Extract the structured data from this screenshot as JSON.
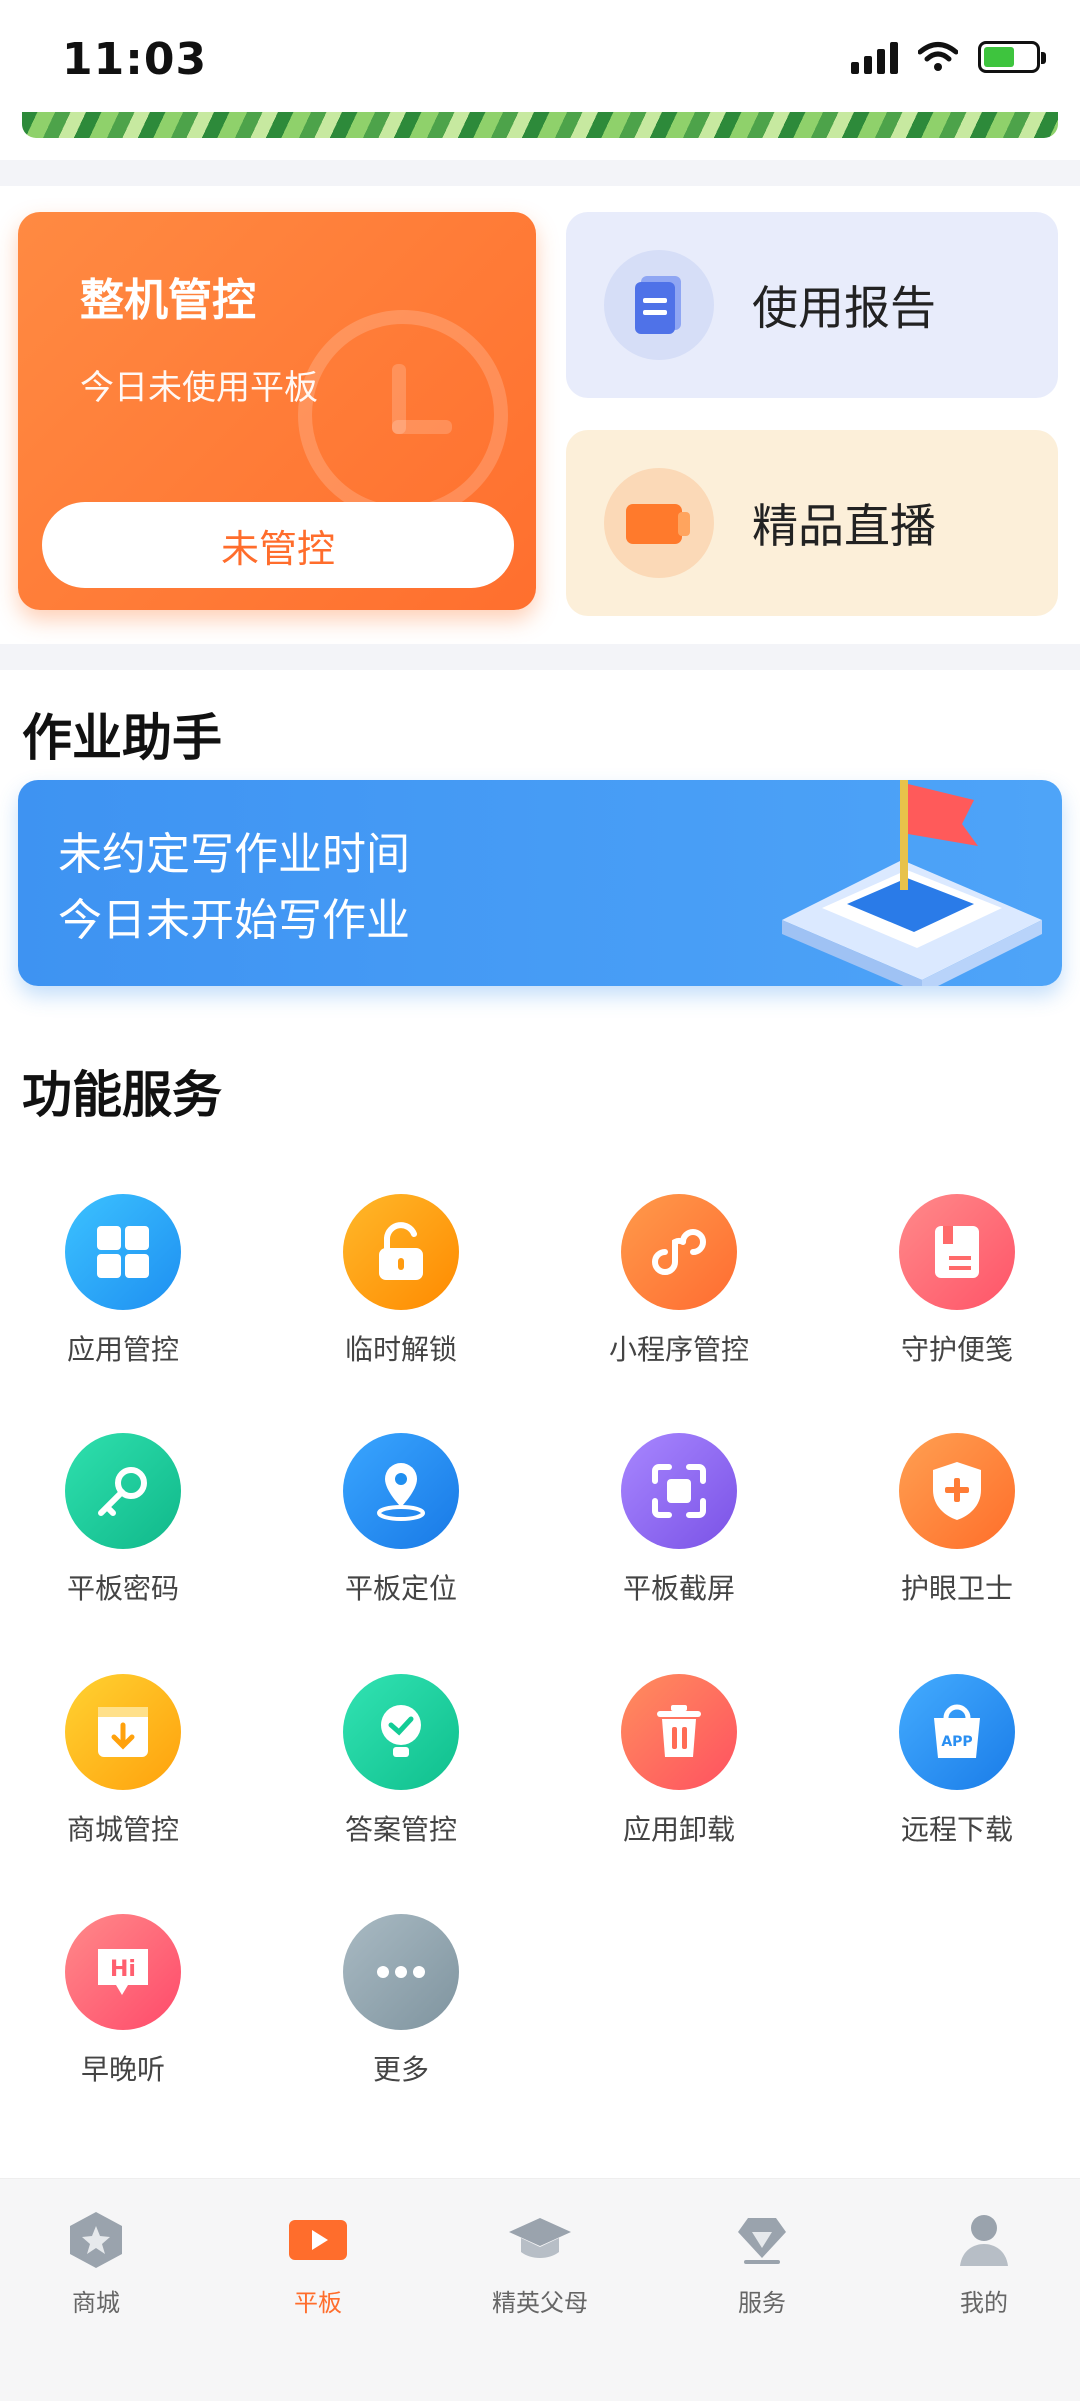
{
  "status_bar": {
    "time": "11:03"
  },
  "control_card": {
    "title": "整机管控",
    "subtitle": "今日未使用平板",
    "button_label": "未管控"
  },
  "report_card": {
    "label": "使用报告"
  },
  "live_card": {
    "label": "精品直播"
  },
  "homework": {
    "section_title": "作业助手",
    "line1": "未约定写作业时间",
    "line2": "今日未开始写作业"
  },
  "services": {
    "section_title": "功能服务",
    "items": [
      {
        "label": "应用管控",
        "icon": "apps-grid-icon",
        "color": "#1e9ef1"
      },
      {
        "label": "临时解锁",
        "icon": "unlock-icon",
        "color": "#ff9b10"
      },
      {
        "label": "小程序管控",
        "icon": "mini-program-icon",
        "color": "#ff7a3a"
      },
      {
        "label": "守护便笺",
        "icon": "note-icon",
        "color": "#ff6a6a"
      },
      {
        "label": "平板密码",
        "icon": "key-icon",
        "color": "#18c996"
      },
      {
        "label": "平板定位",
        "icon": "location-pin-icon",
        "color": "#1f8ff0"
      },
      {
        "label": "平板截屏",
        "icon": "screenshot-icon",
        "color": "#8e67ee"
      },
      {
        "label": "护眼卫士",
        "icon": "shield-plus-icon",
        "color": "#ff7c35"
      },
      {
        "label": "商城管控",
        "icon": "store-download-icon",
        "color": "#ffba16"
      },
      {
        "label": "答案管控",
        "icon": "answer-check-icon",
        "color": "#13cc96"
      },
      {
        "label": "应用卸载",
        "icon": "trash-icon",
        "color": "#ff6c55"
      },
      {
        "label": "远程下载",
        "icon": "app-bag-icon",
        "color": "#2a8ff2"
      },
      {
        "label": "早晚听",
        "icon": "hi-bubble-icon",
        "color": "#ff5f6f"
      },
      {
        "label": "更多",
        "icon": "more-dots-icon",
        "color": "#8fa3ad"
      }
    ]
  },
  "tabbar": {
    "items": [
      {
        "label": "商城",
        "icon": "store-hexagon-icon"
      },
      {
        "label": "平板",
        "icon": "play-tablet-icon",
        "active": true
      },
      {
        "label": "精英父母",
        "icon": "graduation-cap-icon"
      },
      {
        "label": "服务",
        "icon": "diamond-icon"
      },
      {
        "label": "我的",
        "icon": "user-icon"
      }
    ]
  },
  "colors": {
    "accent_orange": "#ff6d2c",
    "homework_blue": "#3e93f2"
  }
}
